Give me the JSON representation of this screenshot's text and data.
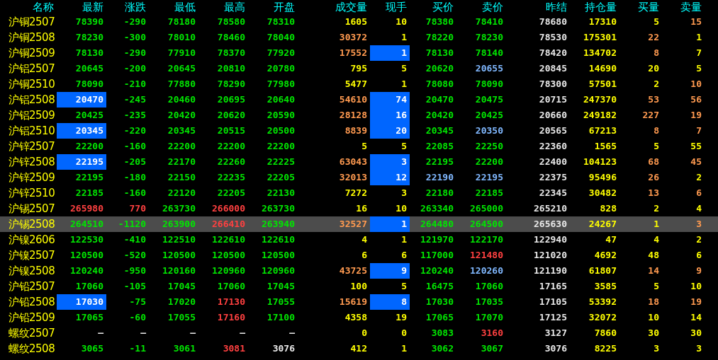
{
  "columns": [
    "名称",
    "最新",
    "涨跌",
    "最低",
    "最高",
    "开盘",
    "成交量",
    "现手",
    "买价",
    "卖价",
    "昨结",
    "持仓量",
    "买量",
    "卖量"
  ],
  "rows": [
    {
      "name": "沪铜2507",
      "selected": false,
      "cells": [
        {
          "text": "78390",
          "color": "#00e600",
          "flash": false
        },
        {
          "text": "-290",
          "color": "#00e600",
          "flash": false
        },
        {
          "text": "78180",
          "color": "#00e600",
          "flash": false
        },
        {
          "text": "78580",
          "color": "#00e600",
          "flash": false
        },
        {
          "text": "78310",
          "color": "#00e600",
          "flash": false
        },
        {
          "text": "1605",
          "color": "#ffff00",
          "flash": false
        },
        {
          "text": "10",
          "color": "#ffff00",
          "flash": false
        },
        {
          "text": "78380",
          "color": "#00e600",
          "flash": false
        },
        {
          "text": "78410",
          "color": "#00e600",
          "flash": false
        },
        {
          "text": "78680",
          "color": "#e8e8e8",
          "flash": false
        },
        {
          "text": "17310",
          "color": "#ffff00",
          "flash": false
        },
        {
          "text": "5",
          "color": "#ffff00",
          "flash": false
        },
        {
          "text": "15",
          "color": "#ff9a50",
          "flash": false
        }
      ]
    },
    {
      "name": "沪铜2508",
      "selected": false,
      "cells": [
        {
          "text": "78230",
          "color": "#00e600",
          "flash": false
        },
        {
          "text": "-300",
          "color": "#00e600",
          "flash": false
        },
        {
          "text": "78010",
          "color": "#00e600",
          "flash": false
        },
        {
          "text": "78460",
          "color": "#00e600",
          "flash": false
        },
        {
          "text": "78040",
          "color": "#00e600",
          "flash": false
        },
        {
          "text": "30372",
          "color": "#ff9a50",
          "flash": false
        },
        {
          "text": "1",
          "color": "#ffff00",
          "flash": false
        },
        {
          "text": "78220",
          "color": "#00e600",
          "flash": false
        },
        {
          "text": "78230",
          "color": "#00e600",
          "flash": false
        },
        {
          "text": "78530",
          "color": "#e8e8e8",
          "flash": false
        },
        {
          "text": "175301",
          "color": "#ffff00",
          "flash": false
        },
        {
          "text": "22",
          "color": "#ff9a50",
          "flash": false
        },
        {
          "text": "1",
          "color": "#ffff00",
          "flash": false
        }
      ]
    },
    {
      "name": "沪铜2509",
      "selected": false,
      "cells": [
        {
          "text": "78130",
          "color": "#00e600",
          "flash": false
        },
        {
          "text": "-290",
          "color": "#00e600",
          "flash": false
        },
        {
          "text": "77910",
          "color": "#00e600",
          "flash": false
        },
        {
          "text": "78370",
          "color": "#00e600",
          "flash": false
        },
        {
          "text": "77920",
          "color": "#00e600",
          "flash": false
        },
        {
          "text": "17552",
          "color": "#ff9a50",
          "flash": false
        },
        {
          "text": "1",
          "color": "#ffffff",
          "flash": true
        },
        {
          "text": "78130",
          "color": "#00e600",
          "flash": false
        },
        {
          "text": "78140",
          "color": "#00e600",
          "flash": false
        },
        {
          "text": "78420",
          "color": "#e8e8e8",
          "flash": false
        },
        {
          "text": "134702",
          "color": "#ffff00",
          "flash": false
        },
        {
          "text": "8",
          "color": "#ff9a50",
          "flash": false
        },
        {
          "text": "7",
          "color": "#ffff00",
          "flash": false
        }
      ]
    },
    {
      "name": "沪铝2507",
      "selected": false,
      "cells": [
        {
          "text": "20645",
          "color": "#00e600",
          "flash": false
        },
        {
          "text": "-200",
          "color": "#00e600",
          "flash": false
        },
        {
          "text": "20645",
          "color": "#00e600",
          "flash": false
        },
        {
          "text": "20810",
          "color": "#00e600",
          "flash": false
        },
        {
          "text": "20780",
          "color": "#00e600",
          "flash": false
        },
        {
          "text": "795",
          "color": "#ffff00",
          "flash": false
        },
        {
          "text": "5",
          "color": "#ffff00",
          "flash": false
        },
        {
          "text": "20620",
          "color": "#00e600",
          "flash": false
        },
        {
          "text": "20655",
          "color": "#80b8ff",
          "flash": false
        },
        {
          "text": "20845",
          "color": "#e8e8e8",
          "flash": false
        },
        {
          "text": "14690",
          "color": "#ffff00",
          "flash": false
        },
        {
          "text": "20",
          "color": "#ffff00",
          "flash": false
        },
        {
          "text": "5",
          "color": "#ffff00",
          "flash": false
        }
      ]
    },
    {
      "name": "沪铜2510",
      "selected": false,
      "cells": [
        {
          "text": "78090",
          "color": "#00e600",
          "flash": false
        },
        {
          "text": "-210",
          "color": "#00e600",
          "flash": false
        },
        {
          "text": "77880",
          "color": "#00e600",
          "flash": false
        },
        {
          "text": "78290",
          "color": "#00e600",
          "flash": false
        },
        {
          "text": "77980",
          "color": "#00e600",
          "flash": false
        },
        {
          "text": "5477",
          "color": "#ffff00",
          "flash": false
        },
        {
          "text": "1",
          "color": "#ffff00",
          "flash": false
        },
        {
          "text": "78080",
          "color": "#00e600",
          "flash": false
        },
        {
          "text": "78090",
          "color": "#00e600",
          "flash": false
        },
        {
          "text": "78300",
          "color": "#e8e8e8",
          "flash": false
        },
        {
          "text": "57501",
          "color": "#ffff00",
          "flash": false
        },
        {
          "text": "2",
          "color": "#ffff00",
          "flash": false
        },
        {
          "text": "10",
          "color": "#ff9a50",
          "flash": false
        }
      ]
    },
    {
      "name": "沪铝2508",
      "selected": false,
      "cells": [
        {
          "text": "20470",
          "color": "#ffffff",
          "flash": true
        },
        {
          "text": "-245",
          "color": "#00e600",
          "flash": false
        },
        {
          "text": "20460",
          "color": "#00e600",
          "flash": false
        },
        {
          "text": "20695",
          "color": "#00e600",
          "flash": false
        },
        {
          "text": "20640",
          "color": "#00e600",
          "flash": false
        },
        {
          "text": "54610",
          "color": "#ff9a50",
          "flash": false
        },
        {
          "text": "74",
          "color": "#ffffff",
          "flash": true
        },
        {
          "text": "20470",
          "color": "#00e600",
          "flash": false
        },
        {
          "text": "20475",
          "color": "#00e600",
          "flash": false
        },
        {
          "text": "20715",
          "color": "#e8e8e8",
          "flash": false
        },
        {
          "text": "247370",
          "color": "#ffff00",
          "flash": false
        },
        {
          "text": "53",
          "color": "#ff9a50",
          "flash": false
        },
        {
          "text": "56",
          "color": "#ff9a50",
          "flash": false
        }
      ]
    },
    {
      "name": "沪铝2509",
      "selected": false,
      "cells": [
        {
          "text": "20425",
          "color": "#00e600",
          "flash": false
        },
        {
          "text": "-235",
          "color": "#00e600",
          "flash": false
        },
        {
          "text": "20420",
          "color": "#00e600",
          "flash": false
        },
        {
          "text": "20620",
          "color": "#00e600",
          "flash": false
        },
        {
          "text": "20590",
          "color": "#00e600",
          "flash": false
        },
        {
          "text": "28128",
          "color": "#ff9a50",
          "flash": false
        },
        {
          "text": "16",
          "color": "#ffffff",
          "flash": true
        },
        {
          "text": "20420",
          "color": "#00e600",
          "flash": false
        },
        {
          "text": "20425",
          "color": "#00e600",
          "flash": false
        },
        {
          "text": "20660",
          "color": "#e8e8e8",
          "flash": false
        },
        {
          "text": "249182",
          "color": "#ffff00",
          "flash": false
        },
        {
          "text": "227",
          "color": "#ff9a50",
          "flash": false
        },
        {
          "text": "19",
          "color": "#ff9a50",
          "flash": false
        }
      ]
    },
    {
      "name": "沪铝2510",
      "selected": false,
      "cells": [
        {
          "text": "20345",
          "color": "#ffffff",
          "flash": true
        },
        {
          "text": "-220",
          "color": "#00e600",
          "flash": false
        },
        {
          "text": "20345",
          "color": "#00e600",
          "flash": false
        },
        {
          "text": "20515",
          "color": "#00e600",
          "flash": false
        },
        {
          "text": "20500",
          "color": "#00e600",
          "flash": false
        },
        {
          "text": "8839",
          "color": "#ff9a50",
          "flash": false
        },
        {
          "text": "20",
          "color": "#ffffff",
          "flash": true
        },
        {
          "text": "20345",
          "color": "#00e600",
          "flash": false
        },
        {
          "text": "20350",
          "color": "#80b8ff",
          "flash": false
        },
        {
          "text": "20565",
          "color": "#e8e8e8",
          "flash": false
        },
        {
          "text": "67213",
          "color": "#ffff00",
          "flash": false
        },
        {
          "text": "8",
          "color": "#ff9a50",
          "flash": false
        },
        {
          "text": "7",
          "color": "#ff9a50",
          "flash": false
        }
      ]
    },
    {
      "name": "沪锌2507",
      "selected": false,
      "cells": [
        {
          "text": "22200",
          "color": "#00e600",
          "flash": false
        },
        {
          "text": "-160",
          "color": "#00e600",
          "flash": false
        },
        {
          "text": "22200",
          "color": "#00e600",
          "flash": false
        },
        {
          "text": "22200",
          "color": "#00e600",
          "flash": false
        },
        {
          "text": "22200",
          "color": "#00e600",
          "flash": false
        },
        {
          "text": "5",
          "color": "#ffff00",
          "flash": false
        },
        {
          "text": "5",
          "color": "#ffff00",
          "flash": false
        },
        {
          "text": "22085",
          "color": "#00e600",
          "flash": false
        },
        {
          "text": "22250",
          "color": "#00e600",
          "flash": false
        },
        {
          "text": "22360",
          "color": "#e8e8e8",
          "flash": false
        },
        {
          "text": "1565",
          "color": "#ffff00",
          "flash": false
        },
        {
          "text": "5",
          "color": "#ffff00",
          "flash": false
        },
        {
          "text": "55",
          "color": "#ffff00",
          "flash": false
        }
      ]
    },
    {
      "name": "沪锌2508",
      "selected": false,
      "cells": [
        {
          "text": "22195",
          "color": "#ffffff",
          "flash": true
        },
        {
          "text": "-205",
          "color": "#00e600",
          "flash": false
        },
        {
          "text": "22170",
          "color": "#00e600",
          "flash": false
        },
        {
          "text": "22260",
          "color": "#00e600",
          "flash": false
        },
        {
          "text": "22225",
          "color": "#00e600",
          "flash": false
        },
        {
          "text": "63043",
          "color": "#ff9a50",
          "flash": false
        },
        {
          "text": "3",
          "color": "#ffffff",
          "flash": true
        },
        {
          "text": "22195",
          "color": "#00e600",
          "flash": false
        },
        {
          "text": "22200",
          "color": "#00e600",
          "flash": false
        },
        {
          "text": "22400",
          "color": "#e8e8e8",
          "flash": false
        },
        {
          "text": "104123",
          "color": "#ffff00",
          "flash": false
        },
        {
          "text": "68",
          "color": "#ff9a50",
          "flash": false
        },
        {
          "text": "45",
          "color": "#ff9a50",
          "flash": false
        }
      ]
    },
    {
      "name": "沪锌2509",
      "selected": false,
      "cells": [
        {
          "text": "22195",
          "color": "#00e600",
          "flash": false
        },
        {
          "text": "-180",
          "color": "#00e600",
          "flash": false
        },
        {
          "text": "22150",
          "color": "#00e600",
          "flash": false
        },
        {
          "text": "22235",
          "color": "#00e600",
          "flash": false
        },
        {
          "text": "22205",
          "color": "#00e600",
          "flash": false
        },
        {
          "text": "32013",
          "color": "#ff9a50",
          "flash": false
        },
        {
          "text": "12",
          "color": "#ffffff",
          "flash": true
        },
        {
          "text": "22190",
          "color": "#80b8ff",
          "flash": false
        },
        {
          "text": "22195",
          "color": "#80b8ff",
          "flash": false
        },
        {
          "text": "22375",
          "color": "#e8e8e8",
          "flash": false
        },
        {
          "text": "95496",
          "color": "#ffff00",
          "flash": false
        },
        {
          "text": "26",
          "color": "#ff9a50",
          "flash": false
        },
        {
          "text": "2",
          "color": "#ffff00",
          "flash": false
        }
      ]
    },
    {
      "name": "沪锌2510",
      "selected": false,
      "cells": [
        {
          "text": "22185",
          "color": "#00e600",
          "flash": false
        },
        {
          "text": "-160",
          "color": "#00e600",
          "flash": false
        },
        {
          "text": "22120",
          "color": "#00e600",
          "flash": false
        },
        {
          "text": "22205",
          "color": "#00e600",
          "flash": false
        },
        {
          "text": "22130",
          "color": "#00e600",
          "flash": false
        },
        {
          "text": "7272",
          "color": "#ffff00",
          "flash": false
        },
        {
          "text": "3",
          "color": "#ffff00",
          "flash": false
        },
        {
          "text": "22180",
          "color": "#00e600",
          "flash": false
        },
        {
          "text": "22185",
          "color": "#00e600",
          "flash": false
        },
        {
          "text": "22345",
          "color": "#e8e8e8",
          "flash": false
        },
        {
          "text": "30482",
          "color": "#ffff00",
          "flash": false
        },
        {
          "text": "13",
          "color": "#ff9a50",
          "flash": false
        },
        {
          "text": "6",
          "color": "#ff9a50",
          "flash": false
        }
      ]
    },
    {
      "name": "沪锡2507",
      "selected": false,
      "cells": [
        {
          "text": "265980",
          "color": "#ff4040",
          "flash": false
        },
        {
          "text": "770",
          "color": "#ff4040",
          "flash": false
        },
        {
          "text": "263730",
          "color": "#00e600",
          "flash": false
        },
        {
          "text": "266000",
          "color": "#ff4040",
          "flash": false
        },
        {
          "text": "263730",
          "color": "#00e600",
          "flash": false
        },
        {
          "text": "16",
          "color": "#ffff00",
          "flash": false
        },
        {
          "text": "10",
          "color": "#ffff00",
          "flash": false
        },
        {
          "text": "263340",
          "color": "#00e600",
          "flash": false
        },
        {
          "text": "265000",
          "color": "#00e600",
          "flash": false
        },
        {
          "text": "265210",
          "color": "#e8e8e8",
          "flash": false
        },
        {
          "text": "828",
          "color": "#ffff00",
          "flash": false
        },
        {
          "text": "2",
          "color": "#ffff00",
          "flash": false
        },
        {
          "text": "4",
          "color": "#ffff00",
          "flash": false
        }
      ]
    },
    {
      "name": "沪锡2508",
      "selected": true,
      "cells": [
        {
          "text": "264510",
          "color": "#00e600",
          "flash": false
        },
        {
          "text": "-1120",
          "color": "#00e600",
          "flash": false
        },
        {
          "text": "263900",
          "color": "#00e600",
          "flash": false
        },
        {
          "text": "266410",
          "color": "#ff4040",
          "flash": false
        },
        {
          "text": "263940",
          "color": "#00e600",
          "flash": false
        },
        {
          "text": "32527",
          "color": "#ff9a50",
          "flash": false
        },
        {
          "text": "1",
          "color": "#ffffff",
          "flash": true
        },
        {
          "text": "264480",
          "color": "#00e600",
          "flash": false
        },
        {
          "text": "264500",
          "color": "#00e600",
          "flash": false
        },
        {
          "text": "265630",
          "color": "#e8e8e8",
          "flash": false
        },
        {
          "text": "24267",
          "color": "#ffff00",
          "flash": false
        },
        {
          "text": "1",
          "color": "#ffff00",
          "flash": false
        },
        {
          "text": "3",
          "color": "#ff9a50",
          "flash": false
        }
      ]
    },
    {
      "name": "沪镍2606",
      "selected": false,
      "cells": [
        {
          "text": "122530",
          "color": "#00e600",
          "flash": false
        },
        {
          "text": "-410",
          "color": "#00e600",
          "flash": false
        },
        {
          "text": "122510",
          "color": "#00e600",
          "flash": false
        },
        {
          "text": "122610",
          "color": "#00e600",
          "flash": false
        },
        {
          "text": "122610",
          "color": "#00e600",
          "flash": false
        },
        {
          "text": "4",
          "color": "#ffff00",
          "flash": false
        },
        {
          "text": "1",
          "color": "#ffff00",
          "flash": false
        },
        {
          "text": "121970",
          "color": "#00e600",
          "flash": false
        },
        {
          "text": "122170",
          "color": "#00e600",
          "flash": false
        },
        {
          "text": "122940",
          "color": "#e8e8e8",
          "flash": false
        },
        {
          "text": "47",
          "color": "#ffff00",
          "flash": false
        },
        {
          "text": "4",
          "color": "#ffff00",
          "flash": false
        },
        {
          "text": "2",
          "color": "#ffff00",
          "flash": false
        }
      ]
    },
    {
      "name": "沪镍2507",
      "selected": false,
      "cells": [
        {
          "text": "120500",
          "color": "#00e600",
          "flash": false
        },
        {
          "text": "-520",
          "color": "#00e600",
          "flash": false
        },
        {
          "text": "120500",
          "color": "#00e600",
          "flash": false
        },
        {
          "text": "120500",
          "color": "#00e600",
          "flash": false
        },
        {
          "text": "120500",
          "color": "#00e600",
          "flash": false
        },
        {
          "text": "6",
          "color": "#ffff00",
          "flash": false
        },
        {
          "text": "6",
          "color": "#ffff00",
          "flash": false
        },
        {
          "text": "117000",
          "color": "#00e600",
          "flash": false
        },
        {
          "text": "121480",
          "color": "#ff4040",
          "flash": false
        },
        {
          "text": "121020",
          "color": "#e8e8e8",
          "flash": false
        },
        {
          "text": "4692",
          "color": "#ffff00",
          "flash": false
        },
        {
          "text": "48",
          "color": "#ffff00",
          "flash": false
        },
        {
          "text": "6",
          "color": "#ffff00",
          "flash": false
        }
      ]
    },
    {
      "name": "沪镍2508",
      "selected": false,
      "cells": [
        {
          "text": "120240",
          "color": "#00e600",
          "flash": false
        },
        {
          "text": "-950",
          "color": "#00e600",
          "flash": false
        },
        {
          "text": "120160",
          "color": "#00e600",
          "flash": false
        },
        {
          "text": "120960",
          "color": "#00e600",
          "flash": false
        },
        {
          "text": "120960",
          "color": "#00e600",
          "flash": false
        },
        {
          "text": "43725",
          "color": "#ff9a50",
          "flash": false
        },
        {
          "text": "9",
          "color": "#ffffff",
          "flash": true
        },
        {
          "text": "120240",
          "color": "#00e600",
          "flash": false
        },
        {
          "text": "120260",
          "color": "#80b8ff",
          "flash": false
        },
        {
          "text": "121190",
          "color": "#e8e8e8",
          "flash": false
        },
        {
          "text": "61807",
          "color": "#ffff00",
          "flash": false
        },
        {
          "text": "14",
          "color": "#ff9a50",
          "flash": false
        },
        {
          "text": "9",
          "color": "#ff9a50",
          "flash": false
        }
      ]
    },
    {
      "name": "沪铅2507",
      "selected": false,
      "cells": [
        {
          "text": "17060",
          "color": "#00e600",
          "flash": false
        },
        {
          "text": "-105",
          "color": "#00e600",
          "flash": false
        },
        {
          "text": "17045",
          "color": "#00e600",
          "flash": false
        },
        {
          "text": "17060",
          "color": "#00e600",
          "flash": false
        },
        {
          "text": "17045",
          "color": "#00e600",
          "flash": false
        },
        {
          "text": "100",
          "color": "#ffff00",
          "flash": false
        },
        {
          "text": "5",
          "color": "#ffff00",
          "flash": false
        },
        {
          "text": "16475",
          "color": "#00e600",
          "flash": false
        },
        {
          "text": "17060",
          "color": "#00e600",
          "flash": false
        },
        {
          "text": "17165",
          "color": "#e8e8e8",
          "flash": false
        },
        {
          "text": "3585",
          "color": "#ffff00",
          "flash": false
        },
        {
          "text": "5",
          "color": "#ffff00",
          "flash": false
        },
        {
          "text": "10",
          "color": "#ffff00",
          "flash": false
        }
      ]
    },
    {
      "name": "沪铅2508",
      "selected": false,
      "cells": [
        {
          "text": "17030",
          "color": "#ffffff",
          "flash": true
        },
        {
          "text": "-75",
          "color": "#00e600",
          "flash": false
        },
        {
          "text": "17020",
          "color": "#00e600",
          "flash": false
        },
        {
          "text": "17130",
          "color": "#ff4040",
          "flash": false
        },
        {
          "text": "17055",
          "color": "#00e600",
          "flash": false
        },
        {
          "text": "15619",
          "color": "#ff9a50",
          "flash": false
        },
        {
          "text": "8",
          "color": "#ffffff",
          "flash": true
        },
        {
          "text": "17030",
          "color": "#00e600",
          "flash": false
        },
        {
          "text": "17035",
          "color": "#00e600",
          "flash": false
        },
        {
          "text": "17105",
          "color": "#e8e8e8",
          "flash": false
        },
        {
          "text": "53392",
          "color": "#ffff00",
          "flash": false
        },
        {
          "text": "18",
          "color": "#ff9a50",
          "flash": false
        },
        {
          "text": "19",
          "color": "#ff9a50",
          "flash": false
        }
      ]
    },
    {
      "name": "沪铅2509",
      "selected": false,
      "cells": [
        {
          "text": "17065",
          "color": "#00e600",
          "flash": false
        },
        {
          "text": "-60",
          "color": "#00e600",
          "flash": false
        },
        {
          "text": "17055",
          "color": "#00e600",
          "flash": false
        },
        {
          "text": "17160",
          "color": "#ff4040",
          "flash": false
        },
        {
          "text": "17100",
          "color": "#00e600",
          "flash": false
        },
        {
          "text": "4358",
          "color": "#ffff00",
          "flash": false
        },
        {
          "text": "19",
          "color": "#ffff00",
          "flash": false
        },
        {
          "text": "17065",
          "color": "#00e600",
          "flash": false
        },
        {
          "text": "17070",
          "color": "#00e600",
          "flash": false
        },
        {
          "text": "17125",
          "color": "#e8e8e8",
          "flash": false
        },
        {
          "text": "32072",
          "color": "#ffff00",
          "flash": false
        },
        {
          "text": "10",
          "color": "#ffff00",
          "flash": false
        },
        {
          "text": "14",
          "color": "#ffff00",
          "flash": false
        }
      ]
    },
    {
      "name": "螺纹2507",
      "selected": false,
      "cells": [
        {
          "text": "—",
          "color": "#e8e8e8",
          "flash": false
        },
        {
          "text": "—",
          "color": "#e8e8e8",
          "flash": false
        },
        {
          "text": "—",
          "color": "#e8e8e8",
          "flash": false
        },
        {
          "text": "—",
          "color": "#e8e8e8",
          "flash": false
        },
        {
          "text": "—",
          "color": "#e8e8e8",
          "flash": false
        },
        {
          "text": "0",
          "color": "#ffff00",
          "flash": false
        },
        {
          "text": "0",
          "color": "#ffff00",
          "flash": false
        },
        {
          "text": "3083",
          "color": "#00e600",
          "flash": false
        },
        {
          "text": "3160",
          "color": "#ff4040",
          "flash": false
        },
        {
          "text": "3127",
          "color": "#e8e8e8",
          "flash": false
        },
        {
          "text": "7860",
          "color": "#ffff00",
          "flash": false
        },
        {
          "text": "30",
          "color": "#ffff00",
          "flash": false
        },
        {
          "text": "30",
          "color": "#ffff00",
          "flash": false
        }
      ]
    },
    {
      "name": "螺纹2508",
      "selected": false,
      "cells": [
        {
          "text": "3065",
          "color": "#00e600",
          "flash": false
        },
        {
          "text": "-11",
          "color": "#00e600",
          "flash": false
        },
        {
          "text": "3061",
          "color": "#00e600",
          "flash": false
        },
        {
          "text": "3081",
          "color": "#ff4040",
          "flash": false
        },
        {
          "text": "3076",
          "color": "#e8e8e8",
          "flash": false
        },
        {
          "text": "412",
          "color": "#ffff00",
          "flash": false
        },
        {
          "text": "1",
          "color": "#ffff00",
          "flash": false
        },
        {
          "text": "3062",
          "color": "#00e600",
          "flash": false
        },
        {
          "text": "3067",
          "color": "#00e600",
          "flash": false
        },
        {
          "text": "3076",
          "color": "#e8e8e8",
          "flash": false
        },
        {
          "text": "8225",
          "color": "#ffff00",
          "flash": false
        },
        {
          "text": "3",
          "color": "#ffff00",
          "flash": false
        },
        {
          "text": "3",
          "color": "#ffff00",
          "flash": false
        }
      ]
    }
  ]
}
